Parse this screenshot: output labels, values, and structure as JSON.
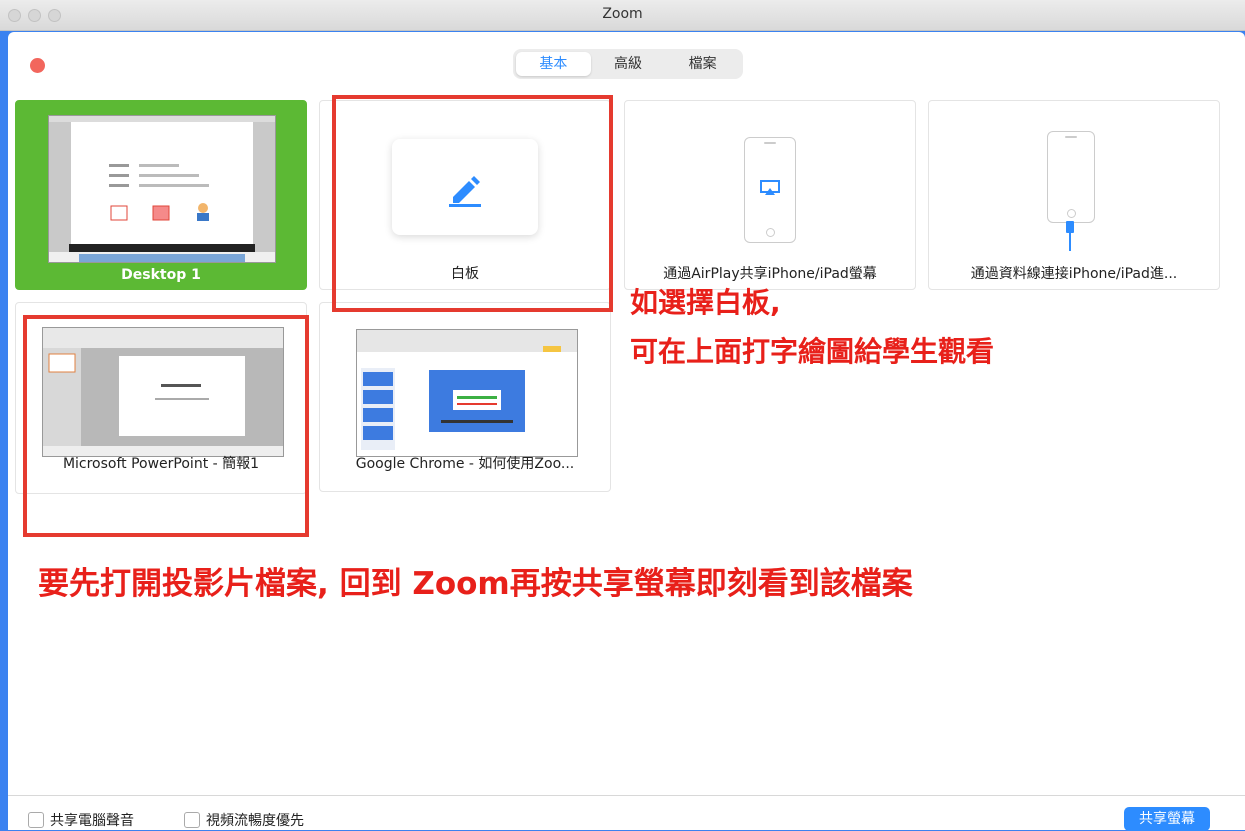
{
  "window": {
    "title": "Zoom"
  },
  "tabs": [
    {
      "label": "基本",
      "active": true
    },
    {
      "label": "高級",
      "active": false
    },
    {
      "label": "檔案",
      "active": false
    }
  ],
  "share_sources": [
    {
      "label": "Desktop 1",
      "kind": "desktop",
      "selected": true
    },
    {
      "label": "白板",
      "kind": "whiteboard",
      "icon": "pencil-icon"
    },
    {
      "label": "通過AirPlay共享iPhone/iPad螢幕",
      "kind": "airplay",
      "icon": "airplay-icon"
    },
    {
      "label": "通過資料線連接iPhone/iPad進...",
      "kind": "cable",
      "icon": "cable-icon"
    },
    {
      "label": "Microsoft PowerPoint - 簡報1",
      "kind": "app-window"
    },
    {
      "label": "Google Chrome - 如何使用Zoo...",
      "kind": "app-window"
    }
  ],
  "annotations": {
    "whiteboard_line1": "如選擇白板,",
    "whiteboard_line2": "可在上面打字繪圖給學生觀看",
    "powerpoint_note": "要先打開投影片檔案, 回到 Zoom再按共享螢幕即刻看到該檔案",
    "color": "#e8201a"
  },
  "footer": {
    "share_audio_label": "共享電腦聲音",
    "share_audio_checked": false,
    "video_priority_label": "視頻流暢度優先",
    "video_priority_checked": false,
    "share_button_label": "共享螢幕"
  },
  "colors": {
    "accent": "#2d8cff",
    "selected": "#5cb934",
    "close": "#f2665d"
  }
}
